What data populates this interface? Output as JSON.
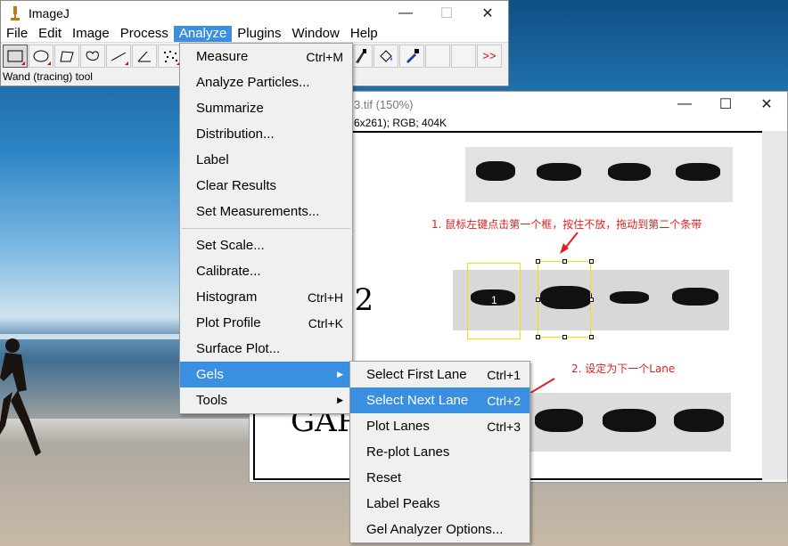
{
  "main_window": {
    "title": "ImageJ",
    "menus": [
      "File",
      "Edit",
      "Image",
      "Process",
      "Analyze",
      "Plugins",
      "Window",
      "Help"
    ],
    "active_menu": "Analyze",
    "status": "Wand (tracing) tool",
    "more_tools_label": ">>"
  },
  "image_window": {
    "title": "3.tif (150%)",
    "info": "6x261); RGB; 404K"
  },
  "image_content": {
    "label_row2": "-2",
    "label_row3": "GAP",
    "lane_number": "1",
    "note1": "1. 鼠标左键点击第一个框，按住不放，拖动到第二个条带",
    "note2": "2. 设定为下一个Lane"
  },
  "analyze_menu": {
    "groups": [
      [
        {
          "label": "Measure",
          "shortcut": "Ctrl+M"
        },
        {
          "label": "Analyze Particles...",
          "shortcut": ""
        },
        {
          "label": "Summarize",
          "shortcut": ""
        },
        {
          "label": "Distribution...",
          "shortcut": ""
        },
        {
          "label": "Label",
          "shortcut": ""
        },
        {
          "label": "Clear Results",
          "shortcut": ""
        },
        {
          "label": "Set Measurements...",
          "shortcut": ""
        }
      ],
      [
        {
          "label": "Set Scale...",
          "shortcut": ""
        },
        {
          "label": "Calibrate...",
          "shortcut": ""
        },
        {
          "label": "Histogram",
          "shortcut": "Ctrl+H"
        },
        {
          "label": "Plot Profile",
          "shortcut": "Ctrl+K"
        },
        {
          "label": "Surface Plot...",
          "shortcut": ""
        },
        {
          "label": "Gels",
          "shortcut": "",
          "submenu": true,
          "highlighted": true
        },
        {
          "label": "Tools",
          "shortcut": "",
          "submenu": true
        }
      ]
    ]
  },
  "gels_menu": {
    "items": [
      {
        "label": "Select First Lane",
        "shortcut": "Ctrl+1"
      },
      {
        "label": "Select Next Lane",
        "shortcut": "Ctrl+2",
        "highlighted": true
      },
      {
        "label": "Plot Lanes",
        "shortcut": "Ctrl+3"
      },
      {
        "label": "Re-plot Lanes",
        "shortcut": ""
      },
      {
        "label": "Reset",
        "shortcut": ""
      },
      {
        "label": "Label Peaks",
        "shortcut": ""
      },
      {
        "label": "Gel Analyzer Options...",
        "shortcut": ""
      }
    ]
  },
  "colors": {
    "highlight": "#3a8fe0",
    "annotation": "#e02020",
    "lane_box": "#f2e200"
  }
}
